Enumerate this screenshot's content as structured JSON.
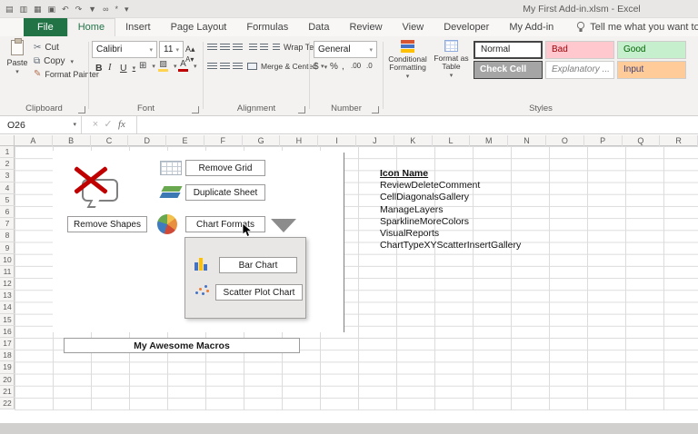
{
  "titlebar": {
    "title": "My First Add-in.xlsm - Excel",
    "qat_icons": [
      {
        "name": "workbook1-icon",
        "glyph": "▤"
      },
      {
        "name": "workbook2-icon",
        "glyph": "▥"
      },
      {
        "name": "workbook3-icon",
        "glyph": "▦"
      },
      {
        "name": "save-icon",
        "glyph": "▣"
      },
      {
        "name": "undo-icon",
        "glyph": "↶"
      },
      {
        "name": "redo-icon",
        "glyph": "↷"
      },
      {
        "name": "filter-icon",
        "glyph": "▼"
      },
      {
        "name": "link-icon",
        "glyph": "∞"
      },
      {
        "name": "addin-flower-icon",
        "glyph": "*"
      },
      {
        "name": "qat-customize-icon",
        "glyph": "▾"
      }
    ]
  },
  "tabs": [
    {
      "name": "tab-file",
      "label": "File"
    },
    {
      "name": "tab-home",
      "label": "Home"
    },
    {
      "name": "tab-insert",
      "label": "Insert"
    },
    {
      "name": "tab-page-layout",
      "label": "Page Layout"
    },
    {
      "name": "tab-formulas",
      "label": "Formulas"
    },
    {
      "name": "tab-data",
      "label": "Data"
    },
    {
      "name": "tab-review",
      "label": "Review"
    },
    {
      "name": "tab-view",
      "label": "View"
    },
    {
      "name": "tab-developer",
      "label": "Developer"
    },
    {
      "name": "tab-my-addin",
      "label": "My Add-in"
    }
  ],
  "tell_me": "Tell me what you want to do",
  "ribbon": {
    "clipboard": {
      "label": "Clipboard",
      "paste": "Paste",
      "cut": "Cut",
      "copy": "Copy",
      "format_painter": "Format Painter"
    },
    "font": {
      "label": "Font",
      "family": "Calibri",
      "size": "11",
      "bold": "B",
      "italic": "I",
      "underline": "U"
    },
    "alignment": {
      "label": "Alignment",
      "wrap_text": "Wrap Text",
      "merge_center": "Merge & Center"
    },
    "number": {
      "label": "Number",
      "format": "General",
      "currency": "$",
      "percent": "%",
      "comma": ",",
      "increase_decimal": ".00",
      "decrease_decimal": ".0"
    },
    "styles": {
      "label": "Styles",
      "conditional": "Conditional Formatting",
      "format_table": "Format as Table",
      "cells": {
        "normal": "Normal",
        "bad": "Bad",
        "good": "Good",
        "check": "Check Cell",
        "explanatory": "Explanatory ...",
        "input": "Input"
      }
    }
  },
  "formula_bar": {
    "name_box": "O26",
    "fx": "fx"
  },
  "grid": {
    "columns": [
      "A",
      "B",
      "C",
      "D",
      "E",
      "F",
      "G",
      "H",
      "I",
      "J",
      "K",
      "L",
      "M",
      "N",
      "O",
      "P",
      "Q",
      "R"
    ],
    "rows": [
      "1",
      "2",
      "3",
      "4",
      "5",
      "6",
      "7",
      "8",
      "9",
      "10",
      "11",
      "12",
      "13",
      "14",
      "15",
      "16",
      "17",
      "18",
      "19",
      "20",
      "21",
      "22"
    ]
  },
  "sheet": {
    "remove_grid": "Remove Grid",
    "duplicate_sheet": "Duplicate Sheet",
    "remove_shapes": "Remove Shapes",
    "chart_formats": "Chart Formats",
    "dropdown": {
      "bar_chart": "Bar Chart",
      "scatter_chart": "Scatter Plot Chart"
    },
    "macros_header": "My Awesome Macros",
    "icon_list": {
      "header": "Icon Name",
      "items": [
        "ReviewDeleteComment",
        "CellDiagonalsGallery",
        "ManageLayers",
        "SparklineMoreColors",
        "VisualReports",
        "ChartTypeXYScatterInsertGallery"
      ]
    }
  },
  "colors": {
    "excel_green": "#217346",
    "bad_bg": "#ffc7ce",
    "bad_text": "#9c0006",
    "good_bg": "#c6efce",
    "good_text": "#006100",
    "check_bg": "#a5a5a5",
    "input_bg": "#ffcc99",
    "input_text": "#3f3f76",
    "x_red": "#c00000",
    "dropdown_triangle": "#8c8c8c"
  }
}
